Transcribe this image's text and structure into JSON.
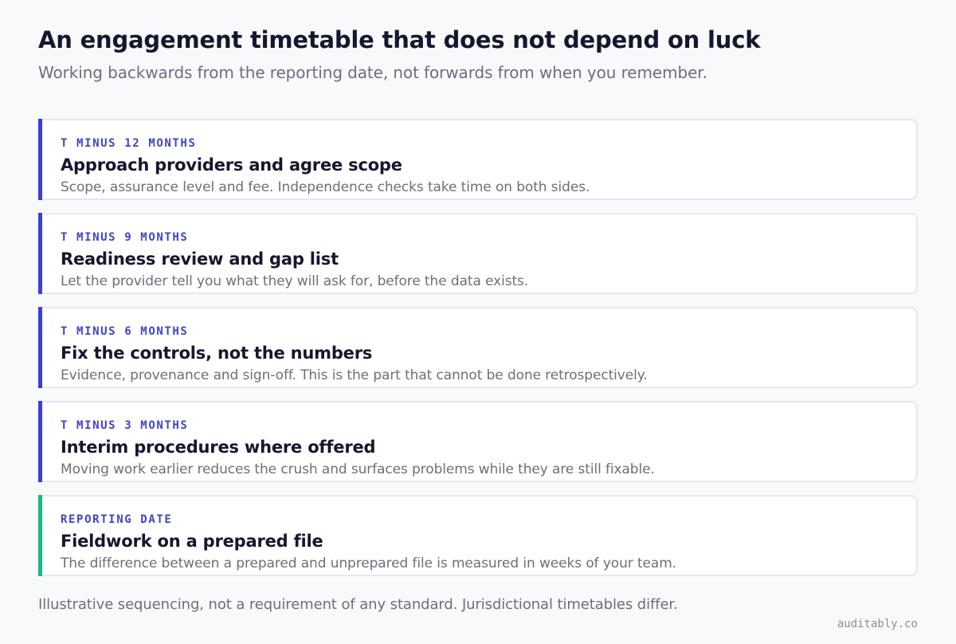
{
  "header": {
    "title": "An engagement timetable that does not depend on luck",
    "subtitle": "Working backwards from the reporting date, not forwards from when you remember."
  },
  "steps": [
    {
      "label": "T MINUS 12 MONTHS",
      "title": "Approach providers and agree scope",
      "desc": "Scope, assurance level and fee. Independence checks take time on both sides."
    },
    {
      "label": "T MINUS 9 MONTHS",
      "title": "Readiness review and gap list",
      "desc": "Let the provider tell you what they will ask for, before the data exists."
    },
    {
      "label": "T MINUS 6 MONTHS",
      "title": "Fix the controls, not the numbers",
      "desc": "Evidence, provenance and sign-off. This is the part that cannot be done retrospectively."
    },
    {
      "label": "T MINUS 3 MONTHS",
      "title": "Interim procedures where offered",
      "desc": "Moving work earlier reduces the crush and surfaces problems while they are still fixable."
    },
    {
      "label": "REPORTING DATE",
      "title": "Fieldwork on a prepared file",
      "desc": "The difference between a prepared and unprepared file is measured in weeks of your team."
    }
  ],
  "footnote": "Illustrative sequencing, not a requirement of any standard. Jurisdictional timetables differ.",
  "brand": "auditably.co",
  "colors": {
    "accent": "#3b3fd8",
    "final_accent": "#1bb883",
    "label": "#4043c9",
    "muted_text": "#6b6f7c"
  }
}
